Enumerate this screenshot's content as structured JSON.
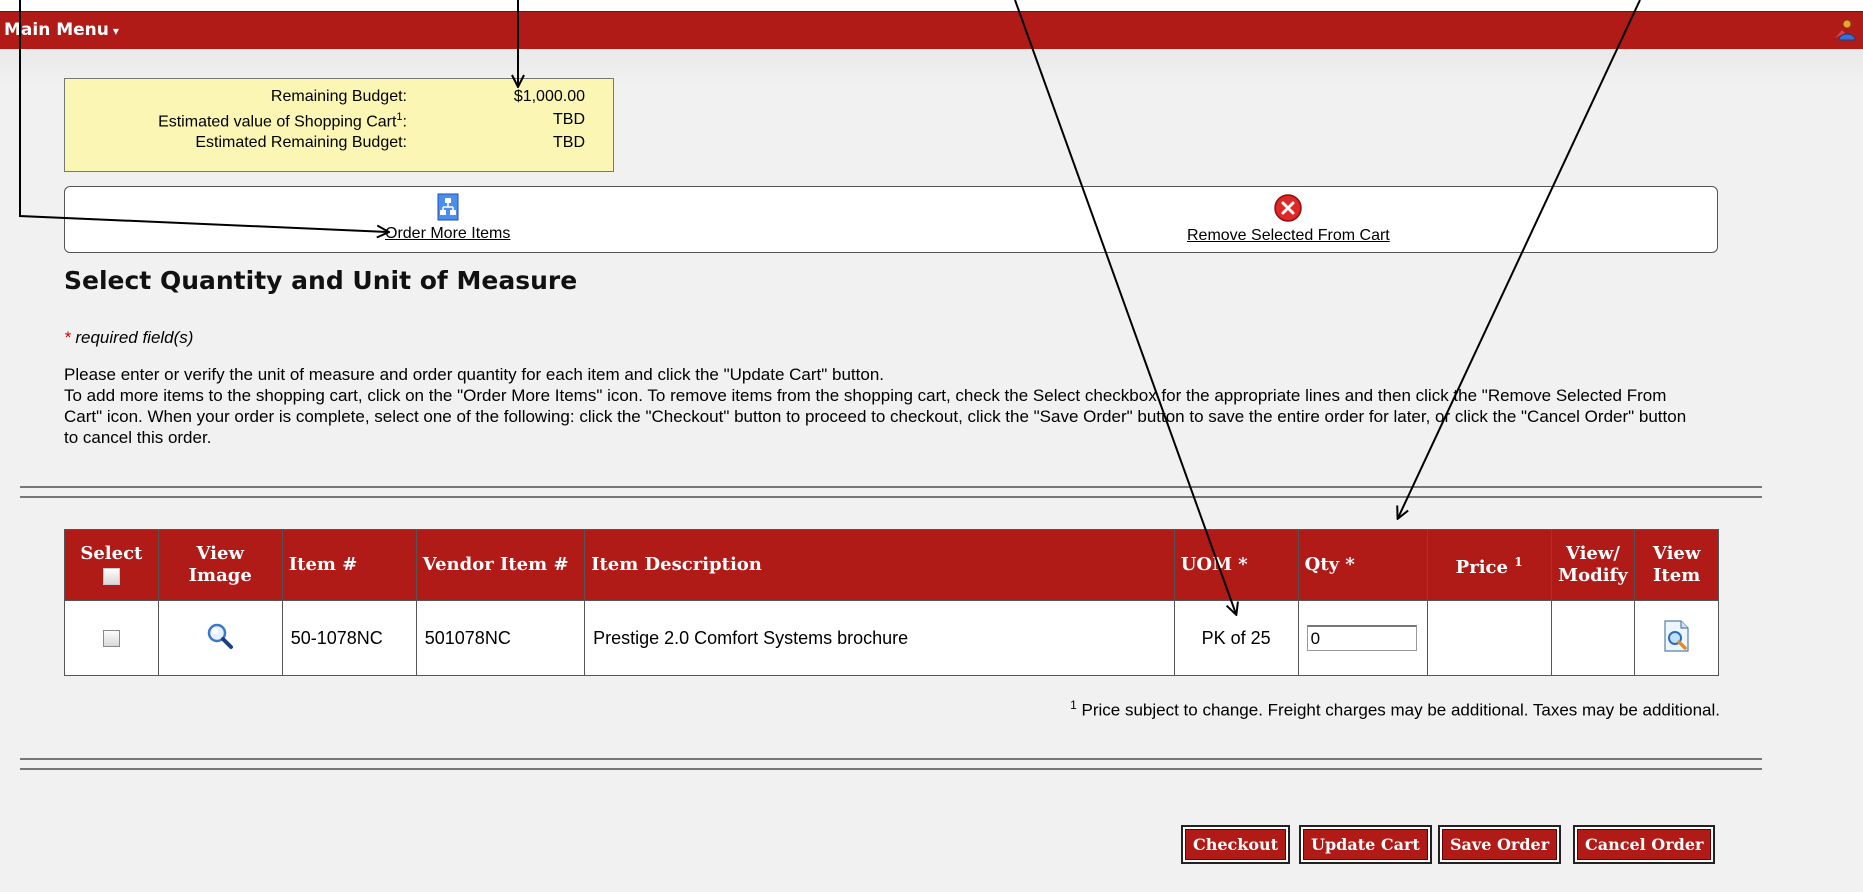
{
  "menu": {
    "label": "Main Menu",
    "caret": "▾"
  },
  "budget": {
    "remaining_label": "Remaining Budget:",
    "remaining_value": "$1,000.00",
    "cart_value_label": "Estimated value of Shopping Cart",
    "cart_value_sup": "1",
    "cart_value_colon": ":",
    "cart_value": "TBD",
    "est_remaining_label": "Estimated Remaining Budget:",
    "est_remaining_value": "TBD"
  },
  "actions": {
    "order_more": "Order More Items",
    "remove_selected": "Remove Selected From Cart"
  },
  "title": "Select Quantity and Unit of Measure",
  "required": {
    "star": "*",
    "text": "required field(s)"
  },
  "instructions": {
    "line1": "Please enter or verify the unit of measure and order quantity for each item and click the \"Update Cart\" button.",
    "line2": "To add more items to the shopping cart, click on the \"Order More Items\" icon. To remove items from the shopping cart, check the Select checkbox for the appropriate lines and then click the \"Remove Selected From Cart\" icon. When your order is complete, select one of the following: click the \"Checkout\" button to proceed to checkout, click the \"Save Order\" button to save the entire order for later, or click the \"Cancel Order\" button to cancel this order."
  },
  "table": {
    "headers": {
      "select": "Select",
      "view_image_1": "View",
      "view_image_2": "Image",
      "item_no": "Item #",
      "vendor_item": "Vendor Item #",
      "description": "Item Description",
      "uom": "UOM *",
      "qty": "Qty *",
      "price": "Price",
      "price_sup": "1",
      "view_modify_1": "View/",
      "view_modify_2": "Modify",
      "view_item_1": "View",
      "view_item_2": "Item"
    },
    "rows": [
      {
        "item_no": "50-1078NC",
        "vendor_item": "501078NC",
        "description": "Prestige 2.0 Comfort Systems brochure",
        "uom": "PK of 25",
        "qty": "0",
        "price": "",
        "view_modify": ""
      }
    ]
  },
  "footnote": {
    "sup": "1",
    "text": "Price subject to change. Freight charges may be additional. Taxes may be additional."
  },
  "buttons": {
    "checkout": "Checkout",
    "update_cart": "Update Cart",
    "save_order": "Save Order",
    "cancel_order": "Cancel Order"
  },
  "colors": {
    "brand": "#b01a17",
    "budget_bg": "#fbf6b3",
    "page_bg": "#f1f1f1"
  },
  "icons": [
    "user-icon",
    "sitemap-icon",
    "remove-icon",
    "magnifier-icon",
    "document-view-icon"
  ]
}
